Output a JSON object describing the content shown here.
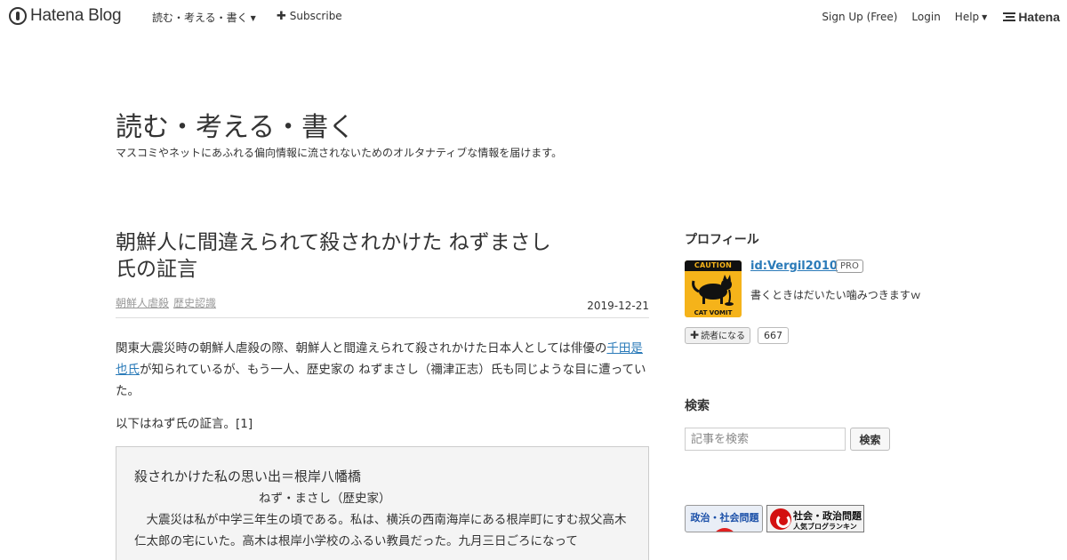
{
  "nav": {
    "logo_text": "Hatena Blog",
    "blog_menu": "読む・考える・書く",
    "subscribe": "Subscribe",
    "signup": "Sign Up (Free)",
    "login": "Login",
    "help": "Help",
    "hatena": "Hatena"
  },
  "blog": {
    "title": "読む・考える・書く",
    "description": "マスコミやネットにあふれる偏向情報に流されないためのオルタナティブな情報を届けます。"
  },
  "entry": {
    "title": "朝鮮人に間違えられて殺されかけた ねずまさし 氏の証言",
    "categories": [
      "朝鮮人虐殺",
      "歴史認識"
    ],
    "date": "2019-12-21",
    "p1_before": "関東大震災時の朝鮮人虐殺の際、朝鮮人と間違えられて殺されかけた日本人としては俳優の",
    "p1_link": "千田是也氏",
    "p1_after": "が知られているが、もう一人、歴史家の ねずまさし（禰津正志）氏も同じような目に遭っていた。",
    "p2": "以下はねず氏の証言。[1]",
    "quote_title": "殺されかけた私の思い出＝根岸八幡橋",
    "quote_author": "ねず・まさし（歴史家）",
    "quote_body": "大震災は私が中学三年生の頃である。私は、横浜の西南海岸にある根岸町にすむ叔父高木仁太郎の宅にいた。高木は根岸小学校のふるい教員だった。九月三日ごろになって"
  },
  "sidebar": {
    "profile_title": "プロフィール",
    "profile_id": "id:Vergil2010",
    "pro_badge": "PRO",
    "profile_desc": "書くときはだいたい噛みつきますｗ",
    "icon_top": "CAUTION",
    "icon_bottom": "CAT VOMIT",
    "subscribe_label": "読者になる",
    "subscriber_count": "667",
    "search_title": "検索",
    "search_placeholder": "記事を検索",
    "search_button": "検索",
    "banner1": "政治・社会問題",
    "banner2_line1": "社会・政治問題",
    "banner2_line2": "人気ブログランキング"
  },
  "colors": {
    "link": "#2b7bb9",
    "icon_yellow": "#f5b31a",
    "quote_bg": "#f4f4f4"
  }
}
